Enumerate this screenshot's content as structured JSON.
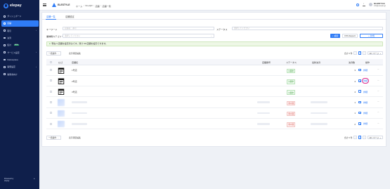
{
  "app": {
    "logo_text": "elepay",
    "brand_name": "ELESTYLE"
  },
  "sidebar": {
    "items": [
      {
        "label": "ダッシュボード",
        "active": false,
        "chevron": ""
      },
      {
        "label": "店舗",
        "active": true,
        "chevron": ""
      },
      {
        "label": "取引",
        "active": false,
        "chevron": "›"
      },
      {
        "label": "決済",
        "active": false,
        "chevron": ""
      },
      {
        "label": "集計",
        "active": false,
        "chevron": "",
        "badge": "NEW"
      },
      {
        "label": "サービス設定",
        "active": false,
        "chevron": "›"
      },
      {
        "label": "Marketplace",
        "active": false,
        "chevron": ""
      },
      {
        "label": "開発設定",
        "active": false,
        "chevron": "›"
      },
      {
        "label": "開発者向け",
        "active": false,
        "chevron": ""
      }
    ],
    "footer_lines": [
      "Powered by",
      "elepay"
    ],
    "footer_icon": "collapse-icon"
  },
  "header": {
    "breadcrumbs": [
      "ホーム",
      "OneQR",
      "店舗",
      "店舗一覧"
    ],
    "user_name": "ELESTYLE",
    "user_email": "info@elestyle.jp"
  },
  "tabs": [
    {
      "label": "店舗一覧",
      "active": true
    },
    {
      "label": "店舗設定",
      "active": false
    }
  ],
  "filters": {
    "keyword_label": "キーワード",
    "keyword_placeholder": "店舗名、番号",
    "status_label": "ステータス",
    "status_placeholder": "選択してください",
    "category_label": "業種等カテゴリー",
    "category_placeholder": "選択してください",
    "search_button": "検索",
    "csv_button": "CSV Export",
    "new_button": "新規"
  },
  "alert": {
    "text": "現在 3 店舗を設定済みです。残り 99 店舗を設定できます。"
  },
  "toolbar": {
    "bulk_select": "一括操作",
    "columns_link": "表示項目編集",
    "total_text": "合計 6 件",
    "current_page": "1",
    "page_size": "10 / ページ"
  },
  "table": {
    "headers": [
      "ロゴ",
      "店舗名",
      "店舗番号",
      "ステータス",
      "最新決済",
      "決済数",
      "操作"
    ],
    "rows": [
      {
        "name": "1号店",
        "status": "公開中",
        "status_type": "pub",
        "count": "3",
        "action": "詳細",
        "circled": false,
        "blurred": false
      },
      {
        "name": "2号店",
        "status": "公開中",
        "status_type": "pub",
        "count": "4",
        "action": "詳細",
        "circled": true,
        "blurred": false
      },
      {
        "name": "3号店",
        "status": "公開中",
        "status_type": "pub",
        "count": "4",
        "action": "詳細",
        "circled": false,
        "blurred": false
      },
      {
        "name": "",
        "status": "非公開",
        "status_type": "unpub",
        "count": "1",
        "action": "詳細",
        "circled": false,
        "blurred": true
      },
      {
        "name": "",
        "status": "非公開",
        "status_type": "unpub",
        "count": "1",
        "action": "詳細",
        "circled": false,
        "blurred": true
      },
      {
        "name": "",
        "status": "非公開",
        "status_type": "unpub",
        "count": "2",
        "action": "詳細",
        "circled": false,
        "blurred": true
      }
    ]
  },
  "colors": {
    "sidebar_bg": "#0f1f4b",
    "accent": "#2f7cf6",
    "highlight_circle": "#e0288b"
  }
}
